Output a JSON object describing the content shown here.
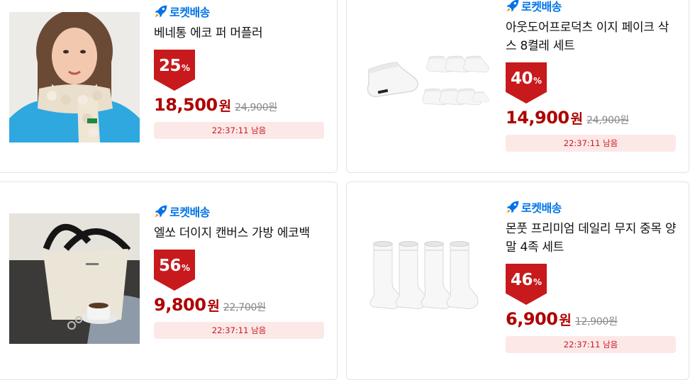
{
  "badge": {
    "label": "로켓배송",
    "icon": "rocket-icon"
  },
  "colors": {
    "accent": "#0073e9",
    "discount": "#c8191d",
    "price": "#ae0000",
    "timer_bg": "#fde8e8"
  },
  "currency": "원",
  "pct_sign": "%",
  "products": [
    {
      "title": "베네통 에코 퍼 머플러",
      "discount": "25",
      "price": "18,500",
      "original_price": "24,900원",
      "timer": "22:37:11 남음",
      "image": "scarf-model-photo"
    },
    {
      "title": "아웃도어프로덕츠 이지 페이크 삭스 8켤레 세트",
      "discount": "40",
      "price": "14,900",
      "original_price": "24,900원",
      "timer": "22:37:11 남음",
      "image": "no-show-socks-photo"
    },
    {
      "title": "엘쏘 더이지 캔버스 가방 에코백",
      "discount": "56",
      "price": "9,800",
      "original_price": "22,700원",
      "timer": "22:37:11 남음",
      "image": "canvas-bag-photo"
    },
    {
      "title": "몬풋 프리미엄 데일리 무지 중목 양말 4족 세트",
      "discount": "46",
      "price": "6,900",
      "original_price": "12,900원",
      "timer": "22:37:11 남음",
      "image": "crew-socks-photo"
    }
  ]
}
